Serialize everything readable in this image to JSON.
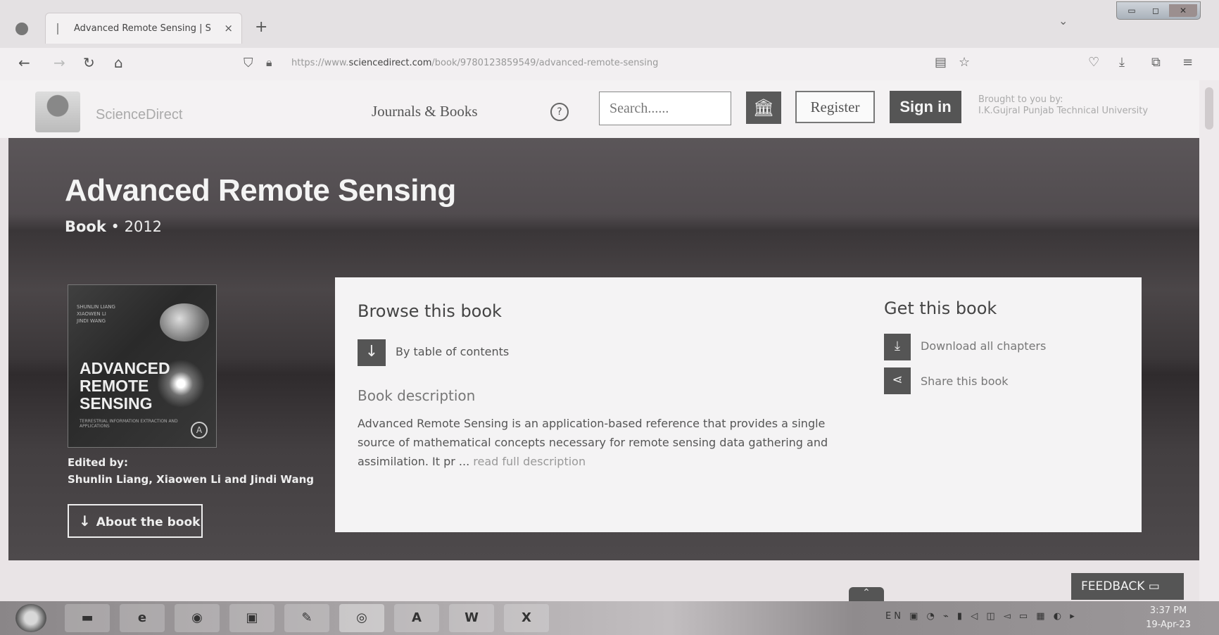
{
  "browser": {
    "tab_title": "Advanced Remote Sensing | Sc",
    "tab_close": "×",
    "new_tab": "+",
    "url_prefix": "https://www.",
    "url_domain": "sciencedirect.com",
    "url_path": "/book/9780123859549/advanced-remote-sensing"
  },
  "header": {
    "site_name": "ScienceDirect",
    "journals_books": "Journals & Books",
    "help": "?",
    "search_placeholder": "Search......",
    "register": "Register",
    "sign_in": "Sign in",
    "brought_label": "Brought to you by:",
    "institution": "I.K.Gujral Punjab Technical University"
  },
  "book": {
    "title": "Advanced Remote Sensing",
    "kind": "Book",
    "bullet": "•",
    "year": "2012",
    "cover_authors": "SHUNLIN LIANG\nXIAOWEN LI\nJINDI WANG",
    "cover_title": "ADVANCED\nREMOTE\nSENSING",
    "cover_subtitle": "TERRESTRIAL INFORMATION EXTRACTION AND APPLICATIONS",
    "edited_by_label": "Edited by:",
    "editors": "Shunlin Liang, Xiaowen Li and Jindi Wang",
    "about_label": "About the book"
  },
  "browse": {
    "heading": "Browse this book",
    "toc_label": "By table of contents",
    "desc_heading": "Book description",
    "description": "Advanced Remote Sensing is an application-based reference that provides a single source of mathematical concepts necessary for remote sensing data gathering and assimilation. It pr ... ",
    "read_more": "read full description"
  },
  "get": {
    "heading": "Get this book",
    "download": "Download all chapters",
    "share": "Share this book"
  },
  "feedback": "FEEDBACK",
  "taskbar": {
    "tray_lang": "EN",
    "time": "3:37 PM",
    "date": "19-Apr-23"
  }
}
